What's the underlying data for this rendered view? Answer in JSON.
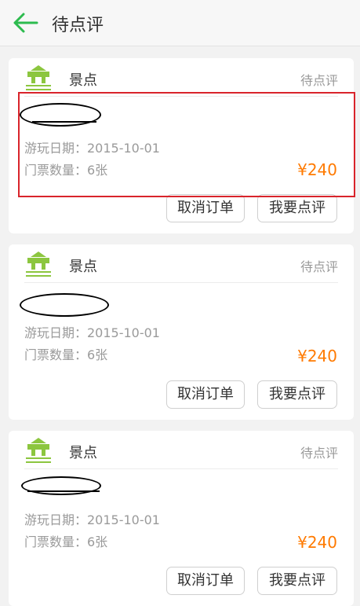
{
  "header": {
    "title": "待点评"
  },
  "orders": [
    {
      "category": "景点",
      "status": "待点评",
      "play_date": "游玩日期：2015-10-01",
      "ticket_qty": "门票数量：6张",
      "price": "¥240",
      "cancel_label": "取消订单",
      "review_label": "我要点评"
    },
    {
      "category": "景点",
      "status": "待点评",
      "play_date": "游玩日期：2015-10-01",
      "ticket_qty": "门票数量：6张",
      "price": "¥240",
      "cancel_label": "取消订单",
      "review_label": "我要点评"
    },
    {
      "category": "景点",
      "status": "待点评",
      "play_date": "游玩日期：2015-10-01",
      "ticket_qty": "门票数量：6张",
      "price": "¥240",
      "cancel_label": "取消订单",
      "review_label": "我要点评"
    }
  ],
  "colors": {
    "accent_green": "#2dbb4f",
    "price_orange": "#ff7a00",
    "highlight_red": "#d9242b"
  },
  "icons": {
    "back": "arrow-left-icon",
    "category": "scenic-spot-icon"
  }
}
